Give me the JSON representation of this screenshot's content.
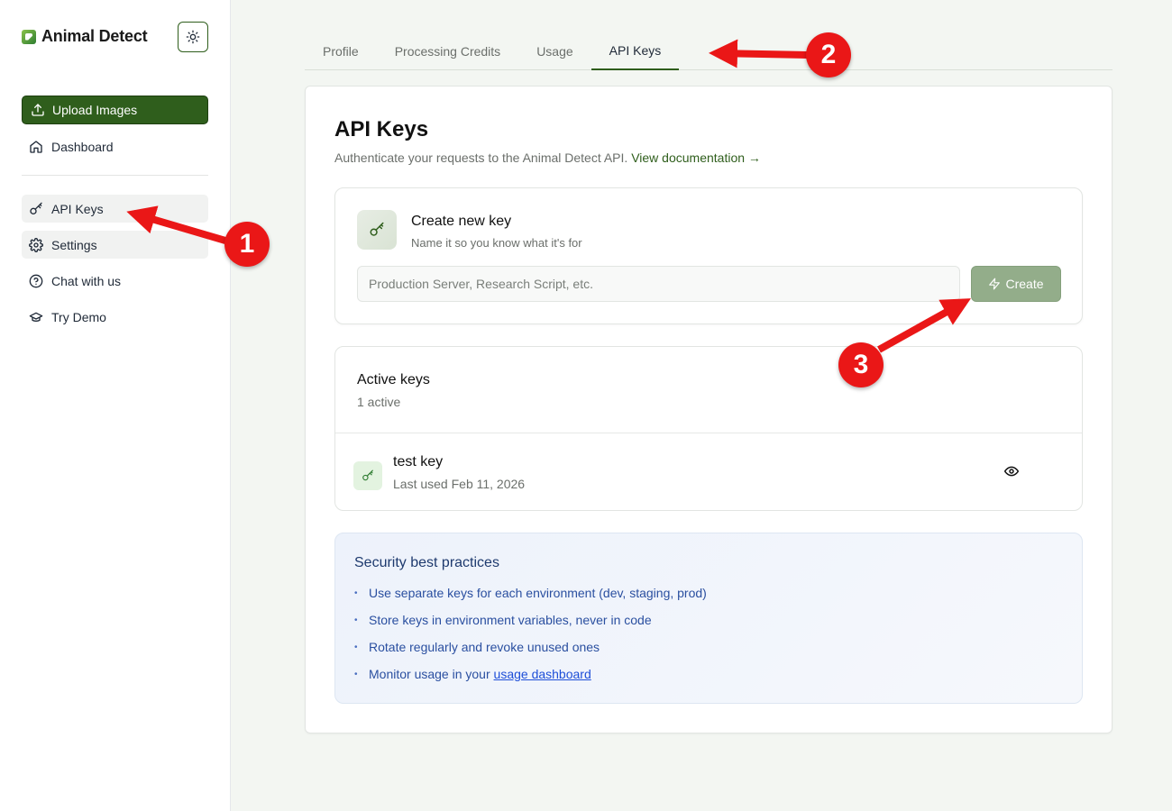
{
  "brand": {
    "name": "Animal Detect"
  },
  "sidebar": {
    "upload_label": "Upload Images",
    "items": [
      {
        "label": "Dashboard",
        "icon": "home-icon"
      },
      {
        "label": "API Keys",
        "icon": "key-icon",
        "active": true
      },
      {
        "label": "Settings",
        "icon": "gear-icon"
      },
      {
        "label": "Chat with us",
        "icon": "help-circle-icon"
      },
      {
        "label": "Try Demo",
        "icon": "graduation-cap-icon"
      }
    ]
  },
  "tabs": [
    {
      "label": "Profile"
    },
    {
      "label": "Processing Credits"
    },
    {
      "label": "Usage"
    },
    {
      "label": "API Keys",
      "active": true
    }
  ],
  "main": {
    "title": "API Keys",
    "subtitle": "Authenticate your requests to the Animal Detect API.",
    "doc_link": "View documentation →",
    "create": {
      "title": "Create new key",
      "subtitle": "Name it so you know what it's for",
      "placeholder": "Production Server, Research Script, etc.",
      "button": "Create"
    },
    "active_keys": {
      "title": "Active keys",
      "count": "1 active",
      "keys": [
        {
          "name": "test key",
          "last_used": "Last used Feb 11, 2026"
        }
      ]
    },
    "security": {
      "title": "Security best practices",
      "tips": [
        "Use separate keys for each environment (dev, staging, prod)",
        "Store keys in environment variables, never in code",
        "Rotate regularly and revoke unused ones"
      ],
      "tip4_prefix": "Monitor usage in your ",
      "tip4_link": "usage dashboard"
    }
  },
  "annotations": {
    "badge1": "1",
    "badge2": "2",
    "badge3": "3",
    "color": "#ea1717"
  },
  "colors": {
    "accent": "#2f5e1c",
    "create_button": "#93ad8a",
    "security_text": "#2a4fa0"
  }
}
